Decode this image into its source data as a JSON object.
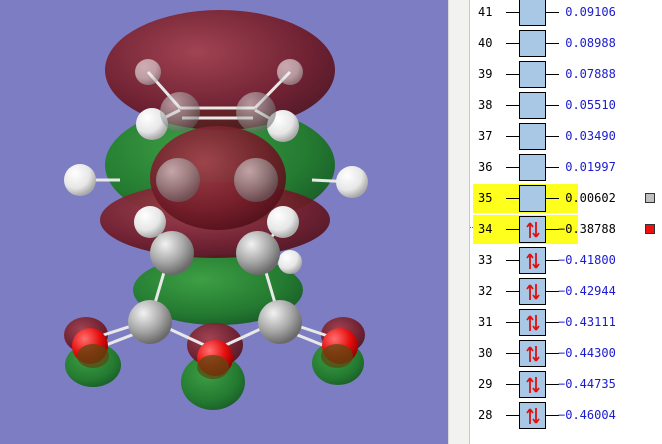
{
  "viewer": {
    "background": "#7d7dc3",
    "colors": {
      "lobe_positive": "#7a1f2a",
      "lobe_negative": "#1f7a2a",
      "carbon": "#9a9a9a",
      "hydrogen": "#f0f0f0",
      "oxygen": "#e01010"
    }
  },
  "levels": [
    {
      "num": "41",
      "energy": "0.09106",
      "occ": "virtual"
    },
    {
      "num": "40",
      "energy": "0.08988",
      "occ": "virtual"
    },
    {
      "num": "39",
      "energy": "0.07888",
      "occ": "virtual"
    },
    {
      "num": "38",
      "energy": "0.05510",
      "occ": "virtual"
    },
    {
      "num": "37",
      "energy": "0.03490",
      "occ": "virtual"
    },
    {
      "num": "36",
      "energy": "0.01997",
      "occ": "virtual"
    },
    {
      "num": "35",
      "energy": "0.00602",
      "occ": "virtual",
      "state": "lumo",
      "marker": "#c0c0c0"
    },
    {
      "num": "34",
      "energy": "-0.38788",
      "occ": "occupied",
      "state": "homo",
      "marker": "#ee1010"
    },
    {
      "num": "33",
      "energy": "-0.41800",
      "occ": "occupied"
    },
    {
      "num": "32",
      "energy": "-0.42944",
      "occ": "occupied"
    },
    {
      "num": "31",
      "energy": "-0.43111",
      "occ": "occupied"
    },
    {
      "num": "30",
      "energy": "-0.44300",
      "occ": "occupied"
    },
    {
      "num": "29",
      "energy": "-0.44735",
      "occ": "occupied"
    },
    {
      "num": "28",
      "energy": "-0.46004",
      "occ": "occupied"
    }
  ],
  "energy_prefix": {
    "virtual": " ",
    "occupied": "-"
  }
}
